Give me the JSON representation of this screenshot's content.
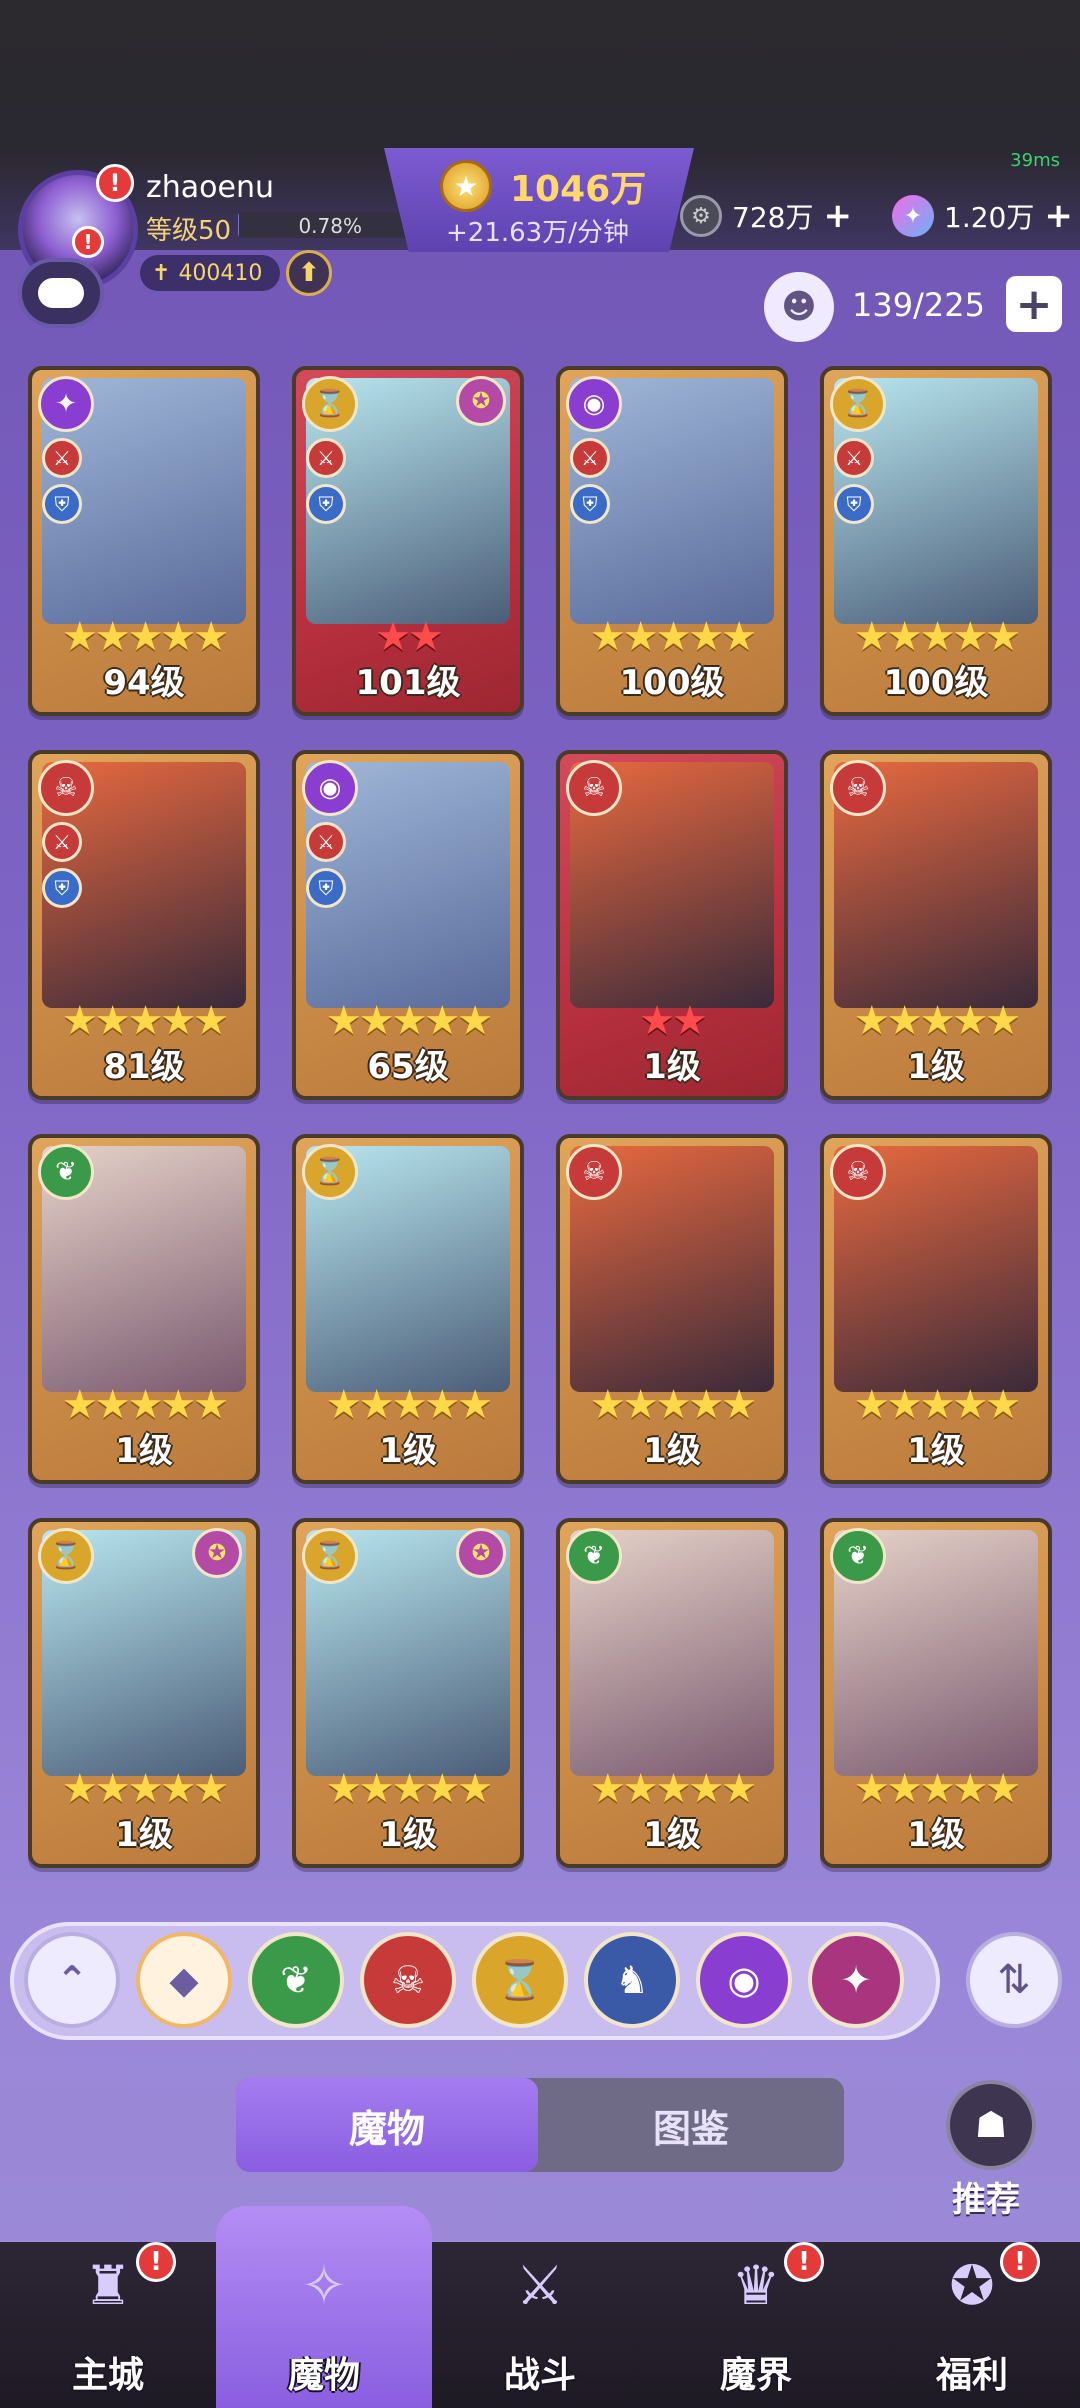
{
  "status": {
    "ping": "39ms"
  },
  "player": {
    "name": "zhaoenu",
    "level_label": "等级50",
    "level_progress_text": "0.78%",
    "level_progress": 0.0078,
    "power": "400410"
  },
  "currency": {
    "gold_amount": "1046万",
    "gold_rate": "+21.63万/分钟",
    "silver_amount": "728万",
    "gem_amount": "1.20万"
  },
  "capacity": {
    "text": "139/225"
  },
  "cards": [
    {
      "level": "94级",
      "stars": "★★★★★",
      "star_color": "gold",
      "frame": "orange",
      "faction": "purple",
      "faction_icon": "✦",
      "has_role": true,
      "has_second": false
    },
    {
      "level": "101级",
      "stars": "★★",
      "star_color": "red",
      "frame": "red",
      "faction": "gold",
      "faction_icon": "⌛",
      "has_role": true,
      "has_second": true
    },
    {
      "level": "100级",
      "stars": "★★★★★",
      "star_color": "gold",
      "frame": "orange",
      "faction": "purple",
      "faction_icon": "◉",
      "has_role": true,
      "has_second": false
    },
    {
      "level": "100级",
      "stars": "★★★★★",
      "star_color": "gold",
      "frame": "orange",
      "faction": "gold",
      "faction_icon": "⌛",
      "has_role": true,
      "has_second": false
    },
    {
      "level": "81级",
      "stars": "★★★★★",
      "star_color": "gold",
      "frame": "orange",
      "faction": "red",
      "faction_icon": "☠",
      "has_role": true,
      "has_second": false
    },
    {
      "level": "65级",
      "stars": "★★★★★",
      "star_color": "gold",
      "frame": "orange",
      "faction": "purple",
      "faction_icon": "◉",
      "has_role": true,
      "has_second": false
    },
    {
      "level": "1级",
      "stars": "★★",
      "star_color": "red",
      "frame": "red",
      "faction": "red",
      "faction_icon": "☠",
      "has_role": false,
      "has_second": false
    },
    {
      "level": "1级",
      "stars": "★★★★★",
      "star_color": "gold",
      "frame": "orange",
      "faction": "red",
      "faction_icon": "☠",
      "has_role": false,
      "has_second": false
    },
    {
      "level": "1级",
      "stars": "★★★★★",
      "star_color": "gold",
      "frame": "orange",
      "faction": "green",
      "faction_icon": "❦",
      "has_role": false,
      "has_second": false
    },
    {
      "level": "1级",
      "stars": "★★★★★",
      "star_color": "gold",
      "frame": "orange",
      "faction": "gold",
      "faction_icon": "⌛",
      "has_role": false,
      "has_second": false
    },
    {
      "level": "1级",
      "stars": "★★★★★",
      "star_color": "gold",
      "frame": "orange",
      "faction": "red",
      "faction_icon": "☠",
      "has_role": false,
      "has_second": false
    },
    {
      "level": "1级",
      "stars": "★★★★★",
      "star_color": "gold",
      "frame": "orange",
      "faction": "red",
      "faction_icon": "☠",
      "has_role": false,
      "has_second": false
    },
    {
      "level": "1级",
      "stars": "★★★★★",
      "star_color": "gold",
      "frame": "orange",
      "faction": "gold",
      "faction_icon": "⌛",
      "has_role": false,
      "has_second": true
    },
    {
      "level": "1级",
      "stars": "★★★★★",
      "star_color": "gold",
      "frame": "orange",
      "faction": "gold",
      "faction_icon": "⌛",
      "has_role": false,
      "has_second": true
    },
    {
      "level": "1级",
      "stars": "★★★★★",
      "star_color": "gold",
      "frame": "orange",
      "faction": "green",
      "faction_icon": "❦",
      "has_role": false,
      "has_second": false
    },
    {
      "level": "1级",
      "stars": "★★★★★",
      "star_color": "gold",
      "frame": "orange",
      "faction": "green",
      "faction_icon": "❦",
      "has_role": false,
      "has_second": false
    }
  ],
  "filters": [
    {
      "name": "collapse",
      "icon": "⌃"
    },
    {
      "name": "all",
      "icon": "◆"
    },
    {
      "name": "nature",
      "icon": "❦",
      "color": "#3a9a4a"
    },
    {
      "name": "demon",
      "icon": "☠",
      "color": "#c73a3a"
    },
    {
      "name": "time",
      "icon": "⌛",
      "color": "#d9a52a"
    },
    {
      "name": "dragon",
      "icon": "♞",
      "color": "#3a5aa8"
    },
    {
      "name": "arcane",
      "icon": "◉",
      "color": "#8a3dd1"
    },
    {
      "name": "chaos",
      "icon": "✦",
      "color": "#a8357d"
    }
  ],
  "tabs": {
    "monsters": "魔物",
    "codex": "图鉴"
  },
  "recommend": {
    "label": "推荐"
  },
  "nav": [
    {
      "label": "主城",
      "icon": "♜",
      "badge": true
    },
    {
      "label": "魔物",
      "icon": "✧",
      "badge": false,
      "active": true
    },
    {
      "label": "战斗",
      "icon": "⚔",
      "badge": false
    },
    {
      "label": "魔界",
      "icon": "♛",
      "badge": true
    },
    {
      "label": "福利",
      "icon": "✪",
      "badge": true
    }
  ],
  "colors": {
    "accent": "#8a5ee0",
    "gold": "#ffd86b",
    "badge": "#e43a3a"
  }
}
